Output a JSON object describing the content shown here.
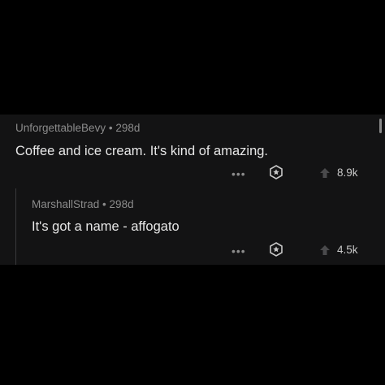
{
  "comments": [
    {
      "author": "UnforgettableBevy",
      "age": "298d",
      "text": "Coffee and ice cream.  It's kind of amazing.",
      "more": "•••",
      "upvotes": "8.9k"
    },
    {
      "author": "MarshallStrad",
      "age": "298d",
      "text": "It's got a name - affogato",
      "more": "•••",
      "upvotes": "4.5k"
    }
  ],
  "separator": "•",
  "colors": {
    "background": "#000000",
    "card": "#131314",
    "meta": "#8b8b8b",
    "text": "#e8e8e8"
  }
}
